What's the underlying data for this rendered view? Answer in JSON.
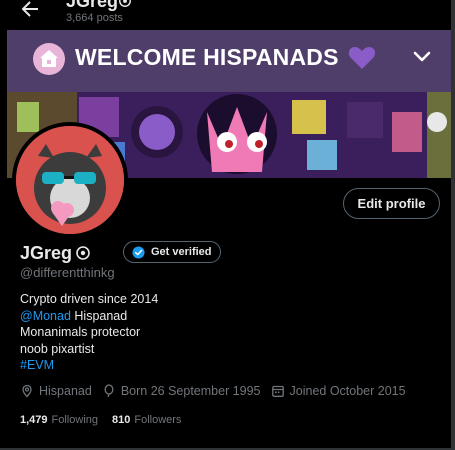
{
  "topbar": {
    "name": "JGreg",
    "posts": "3,664 posts"
  },
  "banner": {
    "title": "WELCOME HISPANADS",
    "colors": {
      "strip": "#503e6a",
      "art_bg": "#3a1f5c",
      "house": "#e8b5d9",
      "heart": "#8a5cc7"
    }
  },
  "profile": {
    "edit_label": "Edit profile",
    "name": "JGreg",
    "verify_label": "Get verified",
    "handle": "@differentthinkg",
    "bio": {
      "line1": "Crypto driven since 2014",
      "line2_link": "@Monad",
      "line2_text": " Hispanad",
      "line3": "Monanimals protector",
      "line4": "noob pixartist",
      "line5_link": "#EVM"
    },
    "meta": {
      "location": "Hispanad",
      "born": "Born 26 September 1995",
      "joined": "Joined October 2015"
    },
    "stats": {
      "following_count": "1,479",
      "following_label": "Following",
      "followers_count": "810",
      "followers_label": "Followers"
    }
  },
  "colors": {
    "background": "#000000",
    "text": "#e7e9ea",
    "muted": "#71767b",
    "link": "#1d9bf0",
    "border": "#536471",
    "avatar_bg": "#d9524d"
  }
}
